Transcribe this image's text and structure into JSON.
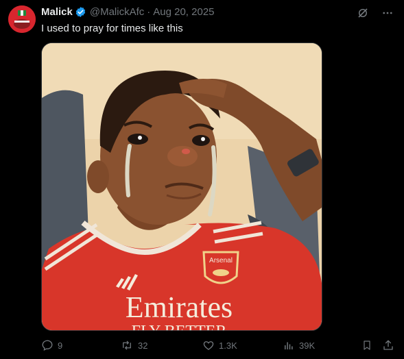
{
  "tweet": {
    "author_name": "Malick",
    "handle": "@MalickAfc",
    "separator": "·",
    "date": "Aug 20, 2025",
    "text": "I used to pray for times like this"
  },
  "media": {
    "jersey_sponsor": "Emirates",
    "jersey_sponsor_line2": "FLY BETTER",
    "crest_text": "Arsenal"
  },
  "actions": {
    "replies": "9",
    "reposts": "32",
    "likes": "1.3K",
    "views": "39K"
  },
  "colors": {
    "background": "#000000",
    "text": "#e7e9ea",
    "muted": "#71767b",
    "verified": "#1d9bf0",
    "jersey_red": "#d8362a"
  },
  "icons": [
    "grok-icon",
    "more-icon",
    "reply-icon",
    "repost-icon",
    "like-icon",
    "views-icon",
    "bookmark-icon",
    "share-icon",
    "verified-badge-icon"
  ]
}
